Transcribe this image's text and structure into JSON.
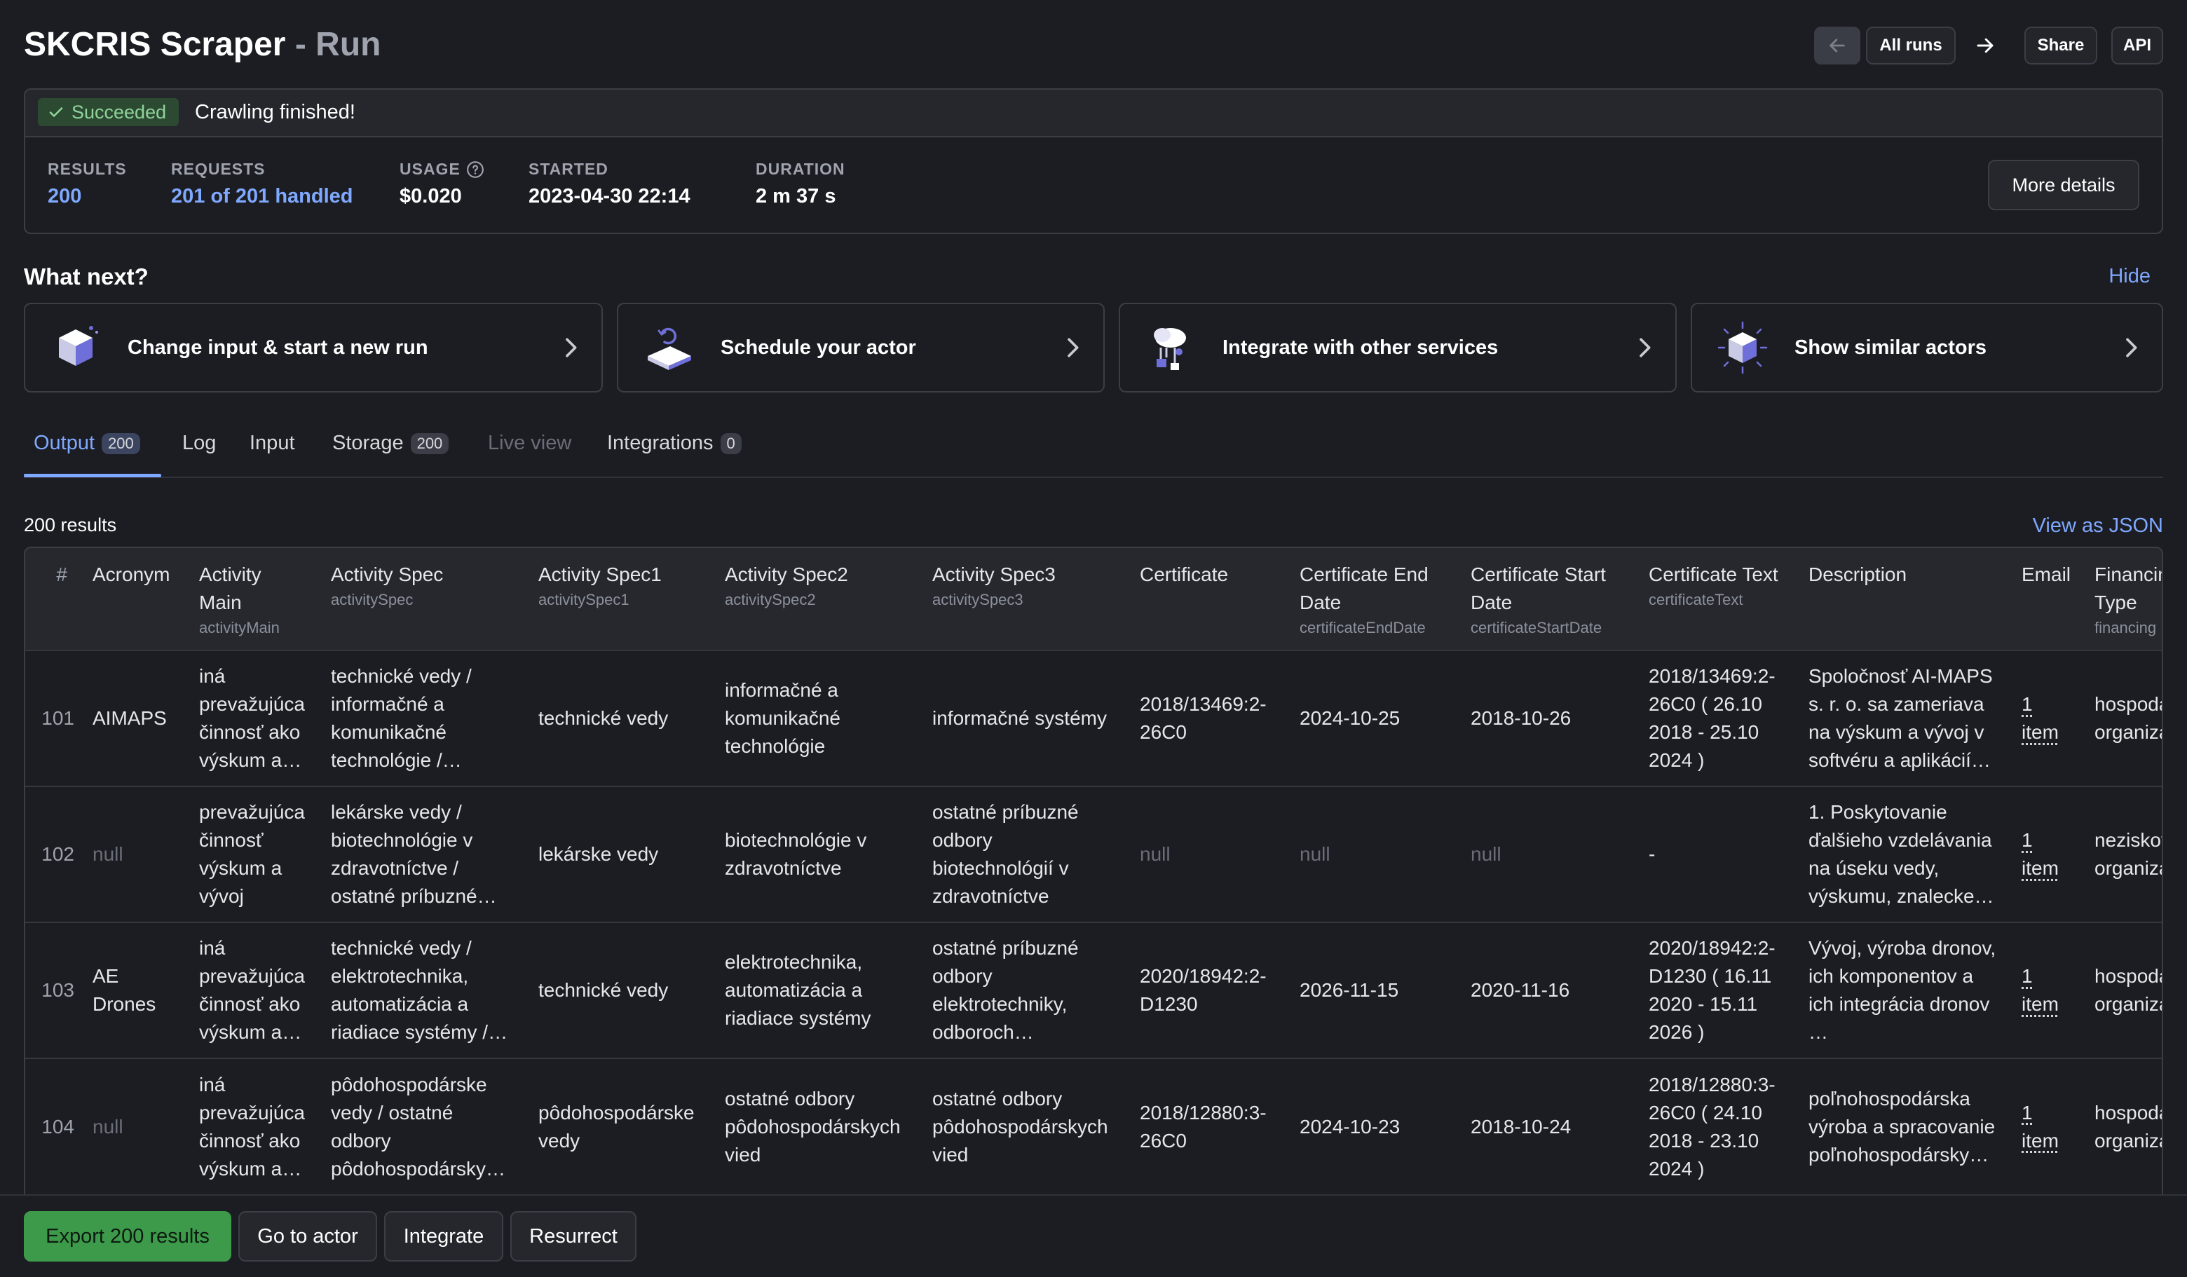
{
  "header": {
    "title": "SKCRIS Scraper",
    "title_suffix": "- Run",
    "buttons": {
      "all_runs": "All runs",
      "share": "Share",
      "api": "API"
    }
  },
  "status": {
    "badge": "Succeeded",
    "message": "Crawling finished!",
    "stats": [
      {
        "label": "RESULTS",
        "value": "200"
      },
      {
        "label": "REQUESTS",
        "value": "201 of 201 handled"
      },
      {
        "label": "USAGE",
        "value": "$0.020"
      },
      {
        "label": "STARTED",
        "value": "2023-04-30 22:14"
      },
      {
        "label": "DURATION",
        "value": "2 m 37 s"
      }
    ],
    "more_details": "More details"
  },
  "what_next": {
    "title": "What next?",
    "hide": "Hide",
    "cards": [
      {
        "label": "Change input & start a new run",
        "icon": "box-icon"
      },
      {
        "label": "Schedule your actor",
        "icon": "schedule-icon"
      },
      {
        "label": "Integrate with other services",
        "icon": "integration-icon"
      },
      {
        "label": "Show similar actors",
        "icon": "similar-icon"
      }
    ]
  },
  "tabs": [
    {
      "label": "Output",
      "count": "200",
      "active": true
    },
    {
      "label": "Log"
    },
    {
      "label": "Input"
    },
    {
      "label": "Storage",
      "count": "200"
    },
    {
      "label": "Live view",
      "disabled": true
    },
    {
      "label": "Integrations",
      "count": "0"
    }
  ],
  "results": {
    "count_label": "200 results",
    "view_json": "View as JSON",
    "columns": [
      {
        "label": "#",
        "key": ""
      },
      {
        "label": "Acronym",
        "key": ""
      },
      {
        "label": "Activity Main",
        "key": "activityMain"
      },
      {
        "label": "Activity Spec",
        "key": "activitySpec"
      },
      {
        "label": "Activity Spec1",
        "key": "activitySpec1"
      },
      {
        "label": "Activity Spec2",
        "key": "activitySpec2"
      },
      {
        "label": "Activity Spec3",
        "key": "activitySpec3"
      },
      {
        "label": "Certificate",
        "key": ""
      },
      {
        "label": "Certificate End Date",
        "key": "certificateEndDate"
      },
      {
        "label": "Certificate Start Date",
        "key": "certificateStartDate"
      },
      {
        "label": "Certificate Text",
        "key": "certificateText"
      },
      {
        "label": "Description",
        "key": ""
      },
      {
        "label": "Email",
        "key": ""
      },
      {
        "label": "Financing Type",
        "key": "financing"
      }
    ],
    "rows": [
      [
        "101",
        "AIMAPS",
        "iná prevažujúca činnosť ako výskum a…",
        "technické vedy / informačné a komunikačné technológie /…",
        "technické vedy",
        "informačné a komunikačné technológie",
        "informačné systémy",
        "2018/13469:2-26C0",
        "2024-10-25",
        "2018-10-26",
        "2018/13469:2-26C0 ( 26.10 2018 - 25.10 2024 )",
        "Spoločnosť AI-MAPS s. r. o. sa zameriava na výskum a vývoj v softvéru a aplikácií…",
        "1 item",
        "hospodárska organizácia"
      ],
      [
        "102",
        "null",
        "prevažujúca činnosť výskum a vývoj",
        "lekárske vedy / biotechnológie v zdravotníctve / ostatné príbuzné…",
        "lekárske vedy",
        "biotechnológie v zdravotníctve",
        "ostatné príbuzné odbory biotechnológií v zdravotníctve",
        "null",
        "null",
        "null",
        "-",
        "1. Poskytovanie ďalšieho vzdelávania na úseku vedy, výskumu, znalecke…",
        "1 item",
        "nezisková organizácia"
      ],
      [
        "103",
        "AE Drones",
        "iná prevažujúca činnosť ako výskum a…",
        "technické vedy / elektrotechnika, automatizácia a riadiace systémy /…",
        "technické vedy",
        "elektrotechnika, automatizácia a riadiace systémy",
        "ostatné príbuzné odbory elektrotechniky, odboroch…",
        "2020/18942:2-D1230",
        "2026-11-15",
        "2020-11-16",
        "2020/18942:2-D1230 ( 16.11 2020 - 15.11 2026 )",
        "Vývoj, výroba dronov, ich komponentov a ich integrácia dronov …",
        "1 item",
        "hospodárska organizácia"
      ],
      [
        "104",
        "null",
        "iná prevažujúca činnosť ako výskum a…",
        "pôdohospodárske vedy / ostatné odbory pôdohospodársky…",
        "pôdohospodárske vedy",
        "ostatné odbory pôdohospodárskych vied",
        "ostatné odbory pôdohospodárskych vied",
        "2018/12880:3-26C0",
        "2024-10-23",
        "2018-10-24",
        "2018/12880:3-26C0 ( 24.10 2018 - 23.10 2024 )",
        "poľnohospodárska výroba a spracovanie poľnohospodársky…",
        "1 item",
        "hospodárska organizácia"
      ]
    ]
  },
  "bottom": {
    "export": "Export 200 results",
    "go_to_actor": "Go to actor",
    "integrate": "Integrate",
    "resurrect": "Resurrect"
  }
}
